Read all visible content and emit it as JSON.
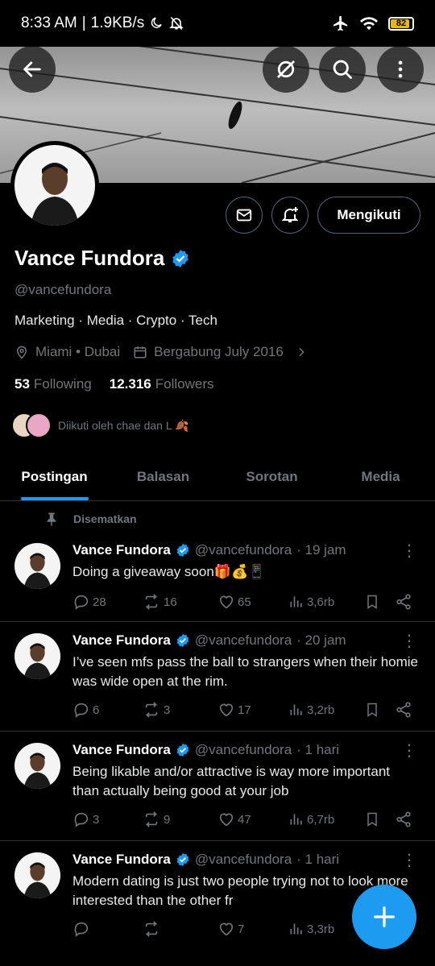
{
  "status_bar": {
    "time": "8:33 AM",
    "speed": "1.9KB/s",
    "battery": "82"
  },
  "profile": {
    "name": "Vance Fundora",
    "handle": "@vancefundora",
    "bio": "Marketing · Media · Crypto · Tech",
    "location": "Miami • Dubai",
    "joined": "Bergabung July 2016",
    "following_count": "53",
    "following_label": "Following",
    "followers_count": "12.316",
    "followers_label": "Followers",
    "followed_by": "Diikuti oleh chae dan L 🍂",
    "follow_button": "Mengikuti"
  },
  "tabs": [
    "Postingan",
    "Balasan",
    "Sorotan",
    "Media"
  ],
  "pinned_label": "Disematkan",
  "tweets": [
    {
      "name": "Vance Fundora",
      "handle": "@vancefundora",
      "time": "· 19 jam",
      "text": "Doing a giveaway soon🎁💰📱",
      "replies": "28",
      "retweets": "16",
      "likes": "65",
      "views": "3,6rb"
    },
    {
      "name": "Vance Fundora",
      "handle": "@vancefundora",
      "time": "· 20 jam",
      "text": "I’ve seen mfs pass the ball to strangers when their homie was wide open at the rim.",
      "replies": "6",
      "retweets": "3",
      "likes": "17",
      "views": "3,2rb"
    },
    {
      "name": "Vance Fundora",
      "handle": "@vancefundora",
      "time": "· 1 hari",
      "text": "Being likable and/or attractive is way more important than actually being good at your job",
      "replies": "3",
      "retweets": "9",
      "likes": "47",
      "views": "6,7rb"
    },
    {
      "name": "Vance Fundora",
      "handle": "@vancefundora",
      "time": "· 1 hari",
      "text": "Modern dating is just two people trying not to look more interested than the other fr",
      "replies": "",
      "retweets": "",
      "likes": "7",
      "views": "3,3rb"
    }
  ],
  "colors": {
    "accent": "#1d9bf0",
    "muted": "#71767b",
    "background": "#000000"
  }
}
